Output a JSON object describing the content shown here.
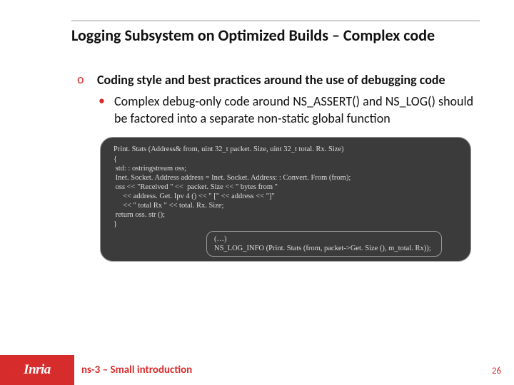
{
  "title": "Logging Subsystem on Optimized Builds – Complex code",
  "bullets": {
    "o1": "Coding style and best practices around the use of debugging code",
    "b1": "Complex debug-only code around NS_ASSERT() and NS_LOG() should be factored into a separate non-static global function"
  },
  "code": {
    "l1": "Print. Stats (Address& from, uint 32_t packet. Size, uint 32_t total. Rx. Size)",
    "l2": "{",
    "l3": " std: : ostringstream oss;",
    "l4": " Inet. Socket. Address address = Inet. Socket. Address: : Convert. From (from);",
    "l5": " oss << \"Received \" <<  packet. Size << \" bytes from \"",
    "l6": "     << address. Get. Ipv 4 () << \" [\" << address << \"]\"",
    "l7": "     << \" total Rx \" << total. Rx. Size;",
    "l8": " return oss. str ();",
    "l9": "}"
  },
  "small": {
    "l1": "(…)",
    "l2": "NS_LOG_INFO (Print. Stats (from, packet->Get. Size (), m_total. Rx));"
  },
  "footer": {
    "logo": "Inria",
    "text": "ns-3 – Small introduction"
  },
  "page": "26"
}
